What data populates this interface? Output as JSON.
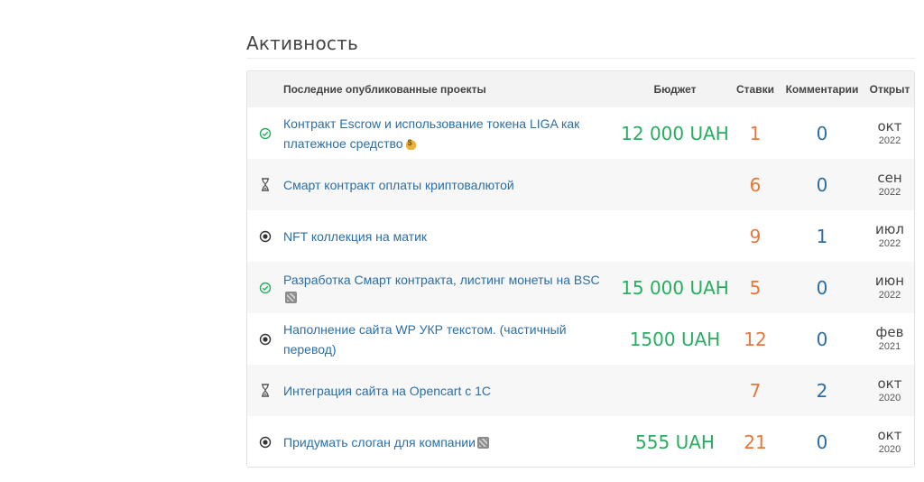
{
  "section": {
    "title": "Активность"
  },
  "table": {
    "headers": {
      "title": "Последние опубликованные проекты",
      "budget": "Бюджет",
      "bids": "Ставки",
      "comments": "Комментарии",
      "opened": "Открыт"
    },
    "rows": [
      {
        "status_icon": "check-circle-icon",
        "title": "Контракт Escrow и использование токена LIGA как платежное средство",
        "emoji": "money-bag-icon",
        "budget": "12 000 UAH",
        "bids": "1",
        "comments": "0",
        "month": "окт",
        "year": "2022"
      },
      {
        "status_icon": "hourglass-icon",
        "title": "Смарт контракт оплаты криптовалютой",
        "emoji": "",
        "budget": "",
        "bids": "6",
        "comments": "0",
        "month": "сен",
        "year": "2022"
      },
      {
        "status_icon": "radio-dot-icon",
        "title": "NFT коллекция на матик",
        "emoji": "",
        "budget": "",
        "bids": "9",
        "comments": "1",
        "month": "июл",
        "year": "2022"
      },
      {
        "status_icon": "check-circle-icon",
        "title": "Разработка Смарт контракта, листинг монеты на BSC",
        "emoji": "placeholder-image-icon",
        "budget": "15 000 UAH",
        "bids": "5",
        "comments": "0",
        "month": "июн",
        "year": "2022"
      },
      {
        "status_icon": "radio-dot-icon",
        "title": "Наполнение сайта WP УКР текстом. (частичный перевод)",
        "emoji": "",
        "budget": "1500 UAH",
        "bids": "12",
        "comments": "0",
        "month": "фев",
        "year": "2021"
      },
      {
        "status_icon": "hourglass-icon",
        "title": "Интеграция сайта на Opencart с 1С",
        "emoji": "",
        "budget": "",
        "bids": "7",
        "comments": "2",
        "month": "окт",
        "year": "2020"
      },
      {
        "status_icon": "radio-dot-icon",
        "title": "Придумать слоган для компании",
        "emoji": "placeholder-image-icon",
        "budget": "555 UAH",
        "bids": "21",
        "comments": "0",
        "month": "окт",
        "year": "2020"
      }
    ]
  },
  "colors": {
    "link": "#2b6ea5",
    "budget": "#27ae60",
    "bids": "#e8763a",
    "check": "#27ae60"
  }
}
